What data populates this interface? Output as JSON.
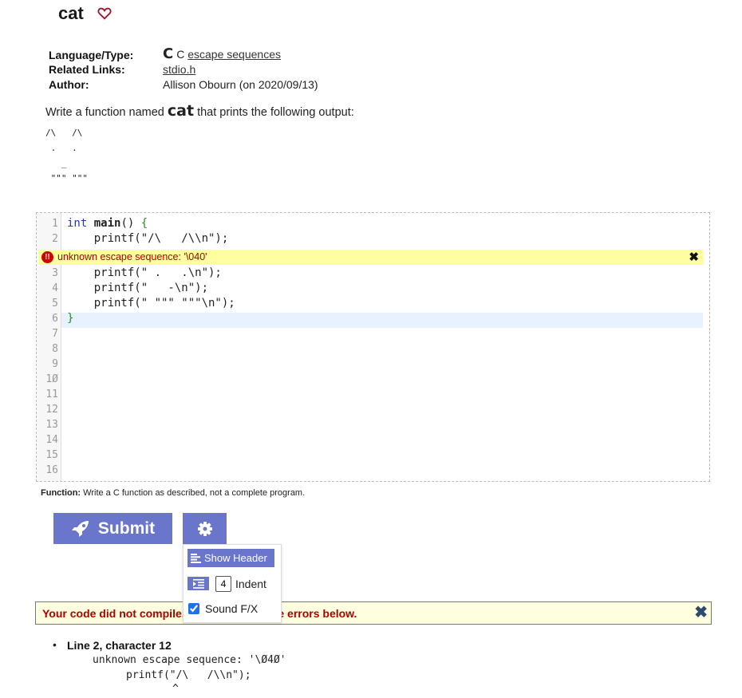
{
  "title": "cat",
  "favorite_icon": "heart-outline-icon",
  "info": {
    "language_label": "Language/Type:",
    "language_icon": "C",
    "language_value": "C",
    "language_link": "escape sequences",
    "related_label": "Related Links:",
    "related_link": "stdio.h",
    "author_label": "Author:",
    "author_value": "Allison Obourn (on 2020/09/13)"
  },
  "description": {
    "before": "Write a function named ",
    "function_name": "cat",
    "after": " that prints the following output:"
  },
  "expected_output": "/\\   /\\\n .   .\n   _\n \"\"\" \"\"\"",
  "editor": {
    "line_numbers": [
      "1",
      "2",
      "3",
      "4",
      "5",
      "6",
      "7",
      "8",
      "9",
      "1Ø",
      "11",
      "12",
      "13",
      "14",
      "15",
      "16"
    ],
    "lines": [
      {
        "kw": "int",
        "fn": "main",
        "rest": "() ",
        "brace": "{"
      },
      {
        "text": "    printf(\"/\\   /\\\\n\");"
      },
      {
        "text": "    printf(\" .   .\\n\");"
      },
      {
        "text": "    printf(\"   -\\n\");"
      },
      {
        "text": "    printf(\" \"\"\" \"\"\"\\n\");"
      },
      {
        "brace": "}"
      }
    ],
    "inline_error": "unknown escape sequence: '\\040'",
    "inline_error_icon": "!!"
  },
  "function_note": {
    "label": "Function:",
    "text": " Write a C function as described, not a complete program."
  },
  "buttons": {
    "submit": "Submit",
    "settings_icon": "gear-icon"
  },
  "settings_menu": {
    "show_header": "Show Header",
    "indent_value": "4",
    "indent_label": "Indent",
    "sound_label": "Sound F/X",
    "sound_checked": true
  },
  "compile_error": {
    "message": "Your code did not compile. Please correct the errors below.",
    "close": "✖"
  },
  "errors": [
    {
      "location": "Line 2, character 12",
      "message": "unknown escape sequence: '\\Ø4Ø'",
      "source": "printf(\"/\\   /\\\\n\");",
      "caret": "^"
    }
  ],
  "colors": {
    "accent": "#6a75cc",
    "error_text": "#b00000",
    "error_bg": "#ffffe0",
    "inline_error_bg": "#ffffa0",
    "active_line": "#e8f2fe"
  }
}
